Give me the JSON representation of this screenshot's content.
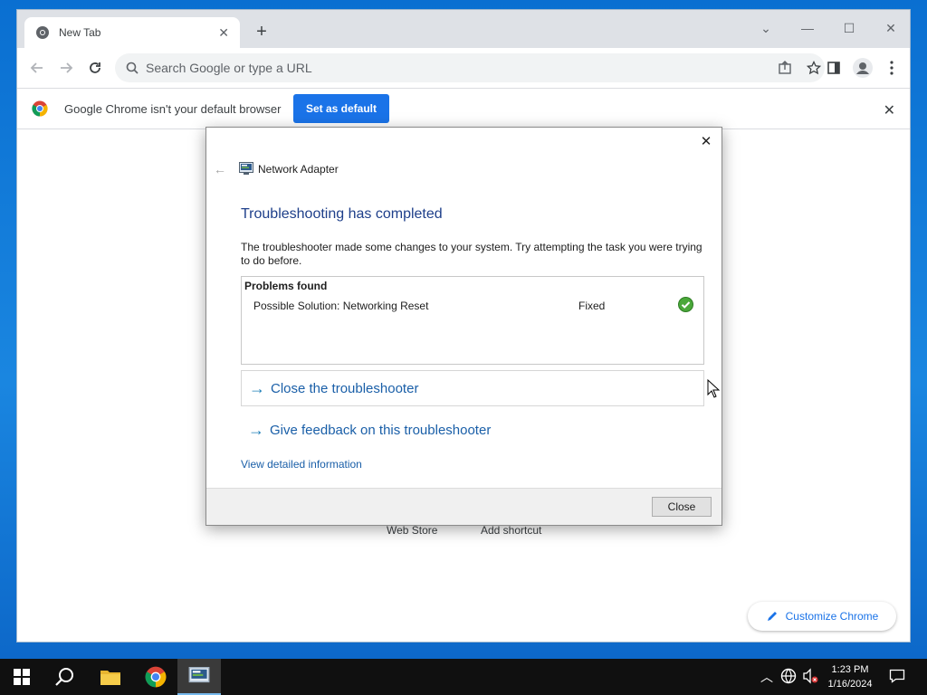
{
  "browser": {
    "tab_title": "New Tab",
    "omnibox_placeholder": "Search Google or type a URL",
    "infobar_message": "Google Chrome isn't your default browser",
    "set_default_label": "Set as default",
    "ntp_links": [
      "Web Store",
      "Add shortcut"
    ],
    "customize_label": "Customize Chrome"
  },
  "dialog": {
    "app_title": "Network Adapter",
    "heading": "Troubleshooting has completed",
    "description": "The troubleshooter made some changes to your system. Try attempting the task you were trying to do before.",
    "problems_header": "Problems found",
    "problems": [
      {
        "name": "Possible Solution: Networking Reset",
        "status": "Fixed",
        "icon": "check-circle-icon"
      }
    ],
    "close_troubleshooter_label": "Close the troubleshooter",
    "feedback_label": "Give feedback on this troubleshooter",
    "detail_link": "View detailed information",
    "close_button": "Close"
  },
  "taskbar": {
    "time": "1:23 PM",
    "date": "1/16/2024"
  },
  "colors": {
    "accent": "#1a73e8",
    "link": "#1a5fa8",
    "heading": "#1e3f8a"
  }
}
